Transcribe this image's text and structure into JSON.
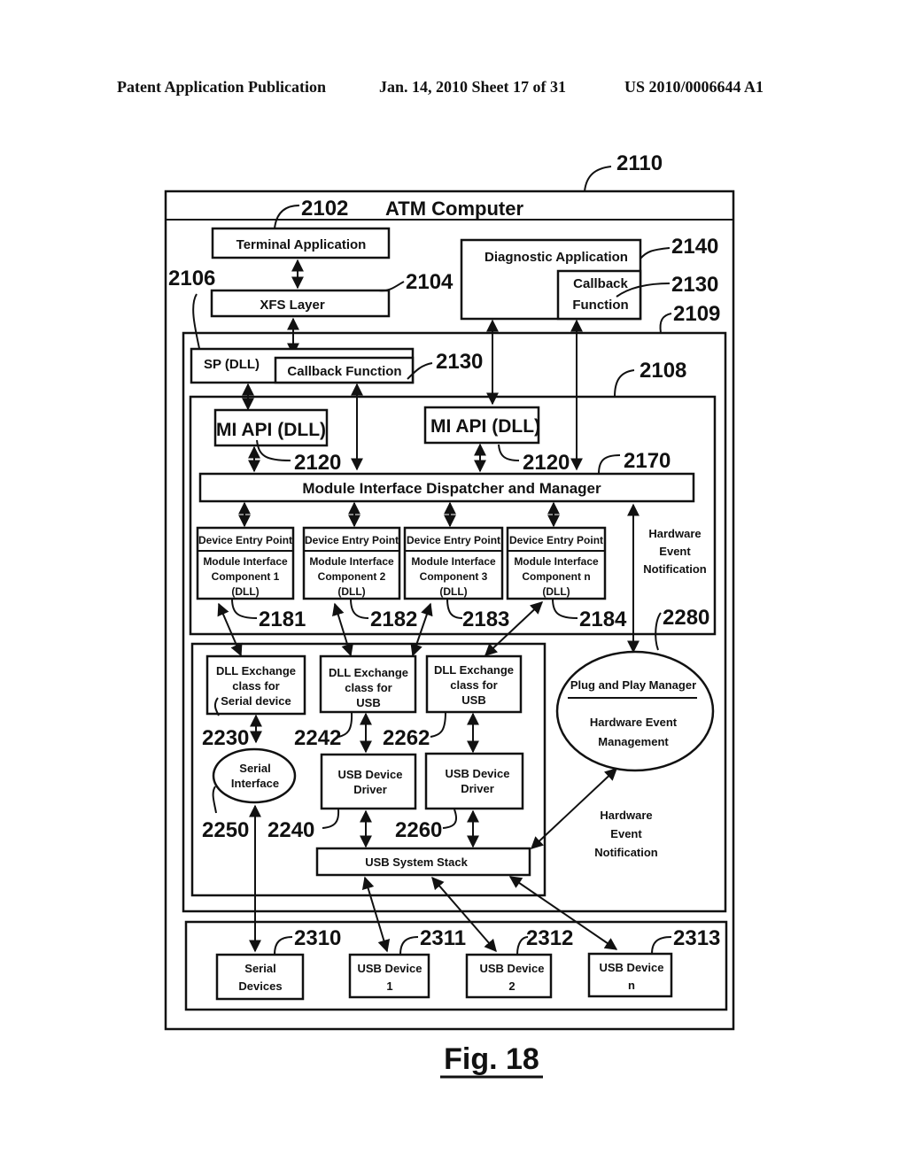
{
  "header": {
    "publication": "Patent Application Publication",
    "date_sheet": "Jan. 14, 2010  Sheet 17 of 31",
    "patent_number": "US 2010/0006644 A1"
  },
  "figure": {
    "label": "Fig. 18",
    "outer": {
      "title": "ATM Computer",
      "ref": "2110"
    },
    "refs": {
      "r2102": "2102",
      "r2106": "2106",
      "r2104": "2104",
      "r2140": "2140",
      "r2130a": "2130",
      "r2109": "2109",
      "r2130b": "2130",
      "r2108": "2108",
      "r2120a": "2120",
      "r2120b": "2120",
      "r2170": "2170",
      "r2181": "2181",
      "r2182": "2182",
      "r2183": "2183",
      "r2184": "2184",
      "r2280": "2280",
      "r2230": "2230",
      "r2242": "2242",
      "r2262": "2262",
      "r2250": "2250",
      "r2240": "2240",
      "r2260": "2260",
      "r2310": "2310",
      "r2311": "2311",
      "r2312": "2312",
      "r2313": "2313"
    },
    "boxes": {
      "terminal_app": "Terminal Application",
      "xfs_layer": "XFS Layer",
      "diagnostic_app": "Diagnostic Application",
      "diag_callback_1": "Callback",
      "diag_callback_2": "Function",
      "sp_dll": "SP (DLL)",
      "sp_callback": "Callback Function",
      "mi_api_1": "MI API (DLL)",
      "mi_api_2": "MI API (DLL)",
      "dispatcher": "Module Interface Dispatcher and Manager",
      "hw_notif_top": [
        "Hardware",
        "Event",
        "Notification"
      ],
      "components": [
        {
          "entry": "Device Entry Point",
          "lines": [
            "Module Interface",
            "Component 1",
            "(DLL)"
          ]
        },
        {
          "entry": "Device Entry Point",
          "lines": [
            "Module Interface",
            "Component 2",
            "(DLL)"
          ]
        },
        {
          "entry": "Device Entry Point",
          "lines": [
            "Module Interface",
            "Component 3",
            "(DLL)"
          ]
        },
        {
          "entry": "Device Entry Point",
          "lines": [
            "Module Interface",
            "Component n",
            "(DLL)"
          ]
        }
      ],
      "dll_serial": [
        "DLL Exchange",
        "class for",
        "Serial device"
      ],
      "dll_usb_1": [
        "DLL Exchange",
        "class for",
        "USB"
      ],
      "dll_usb_2": [
        "DLL Exchange",
        "class for",
        "USB"
      ],
      "serial_interface": [
        "Serial",
        "Interface"
      ],
      "usb_driver_1": [
        "USB Device",
        "Driver"
      ],
      "usb_driver_2": [
        "USB Device",
        "Driver"
      ],
      "usb_stack": "USB System Stack",
      "pnp_title": "Plug and Play Manager",
      "pnp_body": [
        "Hardware Event",
        "Management"
      ],
      "hw_notif_bottom": [
        "Hardware",
        "Event",
        "Notification"
      ],
      "serial_devices": [
        "Serial",
        "Devices"
      ],
      "usb_device_1": [
        "USB Device",
        "1"
      ],
      "usb_device_2": [
        "USB Device",
        "2"
      ],
      "usb_device_n": [
        "USB Device",
        "n"
      ]
    }
  }
}
